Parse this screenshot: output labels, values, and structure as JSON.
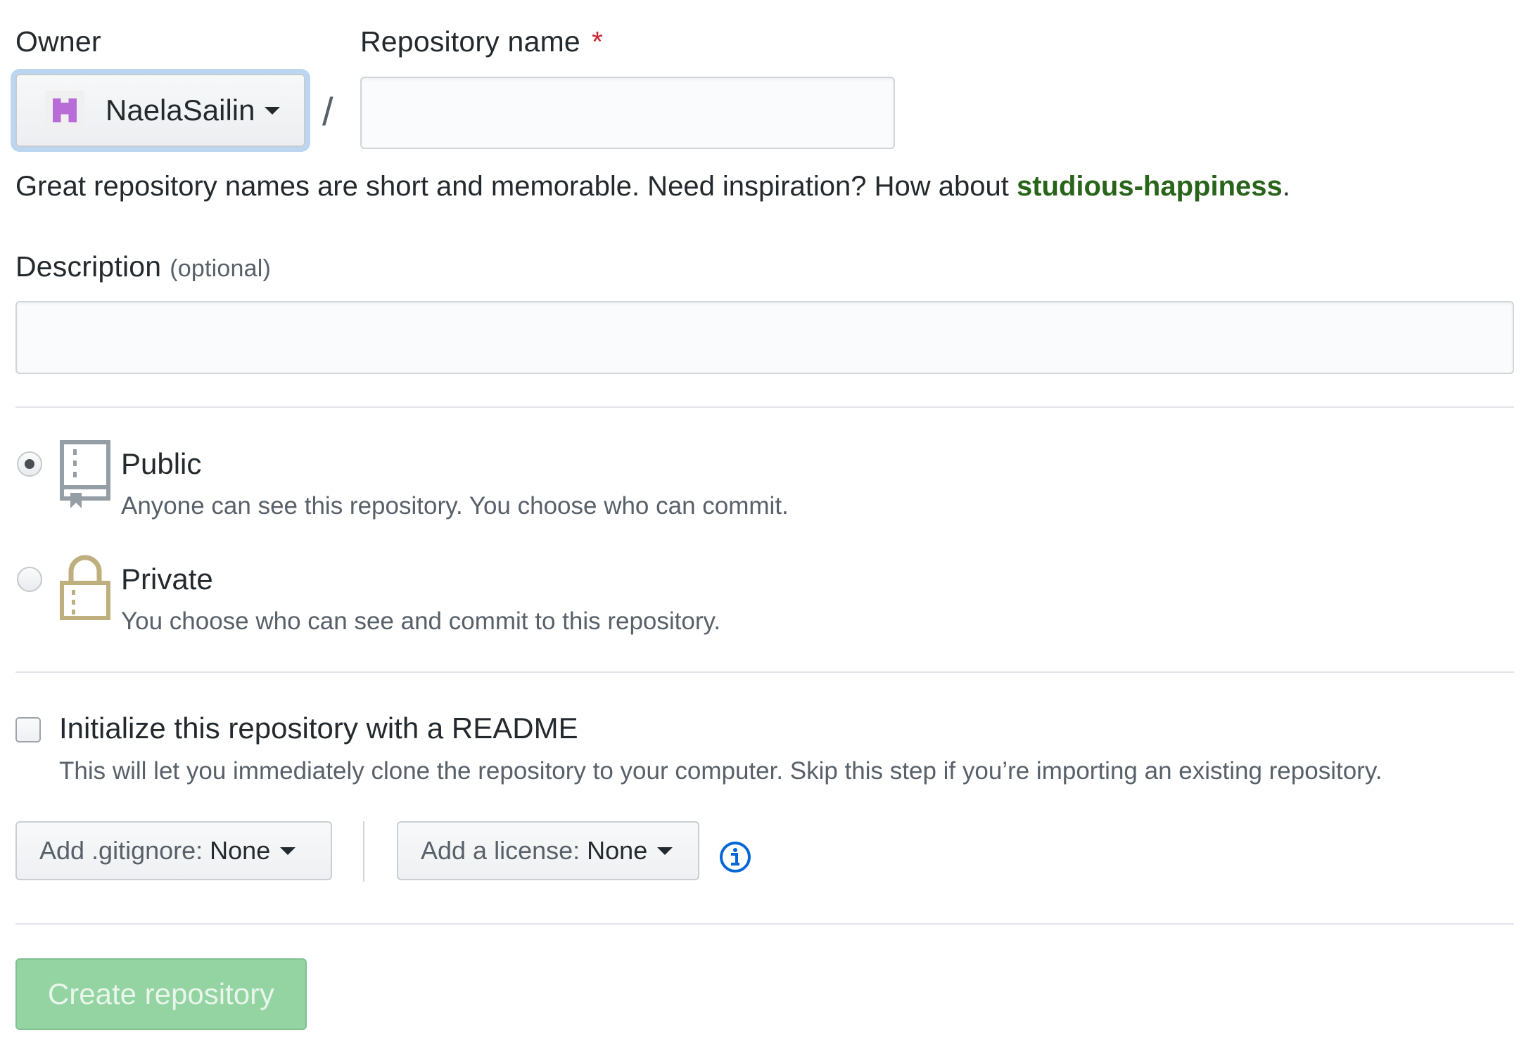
{
  "owner": {
    "label": "Owner",
    "selected": "NaelaSailin"
  },
  "repo_name": {
    "label": "Repository name",
    "required_mark": "*",
    "value": "",
    "separator": "/"
  },
  "name_hint": {
    "text": "Great repository names are short and memorable. Need inspiration? How about ",
    "suggestion": "studious-happiness",
    "end": "."
  },
  "description": {
    "label": "Description",
    "optional": "(optional)",
    "value": ""
  },
  "visibility": {
    "selected": "Public",
    "options": [
      {
        "title": "Public",
        "desc": "Anyone can see this repository. You choose who can commit."
      },
      {
        "title": "Private",
        "desc": "You choose who can see and commit to this repository."
      }
    ]
  },
  "readme": {
    "label": "Initialize this repository with a README",
    "desc": "This will let you immediately clone the repository to your computer. Skip this step if you’re importing an existing repository.",
    "checked": false
  },
  "gitignore": {
    "label": "Add .gitignore:",
    "value": "None"
  },
  "license": {
    "label": "Add a license:",
    "value": "None"
  },
  "icons": {
    "owner_avatar": "identicon-avatar",
    "public": "repo-book-icon",
    "private": "lock-icon",
    "info": "info-icon"
  },
  "colors": {
    "suggestion": "#28641a",
    "required": "#cb2431",
    "create_button": "#94d3a2",
    "focus_ring": "#bcd6f2",
    "info": "#0366d6"
  },
  "submit": {
    "label": "Create repository"
  }
}
